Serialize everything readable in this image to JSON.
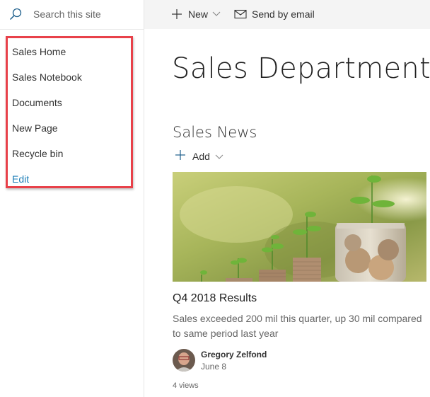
{
  "search": {
    "placeholder": "Search this site"
  },
  "navigation": {
    "items": [
      {
        "label": "Sales Home"
      },
      {
        "label": "Sales Notebook"
      },
      {
        "label": "Documents"
      },
      {
        "label": "New Page"
      },
      {
        "label": "Recycle bin"
      }
    ],
    "edit_label": "Edit",
    "highlight_color": "#e8414a",
    "edit_color": "#1e7fb8"
  },
  "command_bar": {
    "new_label": "New",
    "send_by_email_label": "Send by email"
  },
  "page": {
    "title": "Sales Department"
  },
  "news": {
    "section_title": "Sales News",
    "add_label": "Add",
    "article": {
      "image_alt": "Plants growing from stacks of coins",
      "title": "Q4 2018 Results",
      "description": "Sales exceeded 200 mil this quarter, up 30 mil compared to same period last year",
      "author": "Gregory Zelfond",
      "date": "June 8",
      "views": "4 views"
    }
  }
}
